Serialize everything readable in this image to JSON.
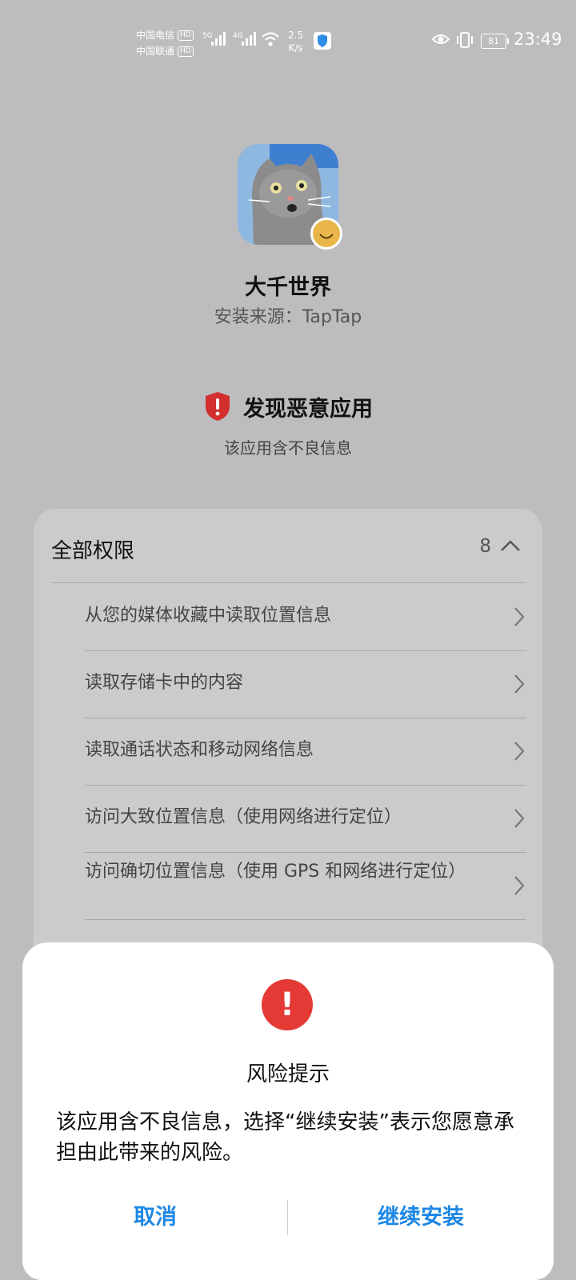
{
  "status_bar": {
    "carrier1": "中国电信",
    "carrier2": "中国联通",
    "hd": "HD",
    "net1": "5G",
    "net2": "4G",
    "speed_value": "2.5",
    "speed_unit": "K/s",
    "battery": "81",
    "time": "23:49"
  },
  "app": {
    "name": "大千世界",
    "source": "安装来源：TapTap"
  },
  "warning": {
    "title": "发现恶意应用",
    "subtitle": "该应用含不良信息"
  },
  "permissions": {
    "header": "全部权限",
    "count": "8",
    "items": [
      "从您的媒体收藏中读取位置信息",
      "读取存储卡中的内容",
      "读取通话状态和移动网络信息",
      "访问大致位置信息（使用网络进行定位）",
      "访问确切位置信息（使用 GPS 和网络进行定位）"
    ]
  },
  "dialog": {
    "icon": "!",
    "title": "风险提示",
    "body": "该应用含不良信息，选择“继续安装”表示您愿意承担由此带来的风险。",
    "cancel": "取消",
    "continue": "继续安装"
  },
  "colors": {
    "accent": "#1e88e5",
    "danger": "#e53935",
    "background": "#bdbdbf"
  },
  "icons": [
    "eye-icon",
    "vibrate-icon",
    "wifi-icon",
    "shield-icon",
    "chevron-up-icon",
    "chevron-right-icon"
  ]
}
